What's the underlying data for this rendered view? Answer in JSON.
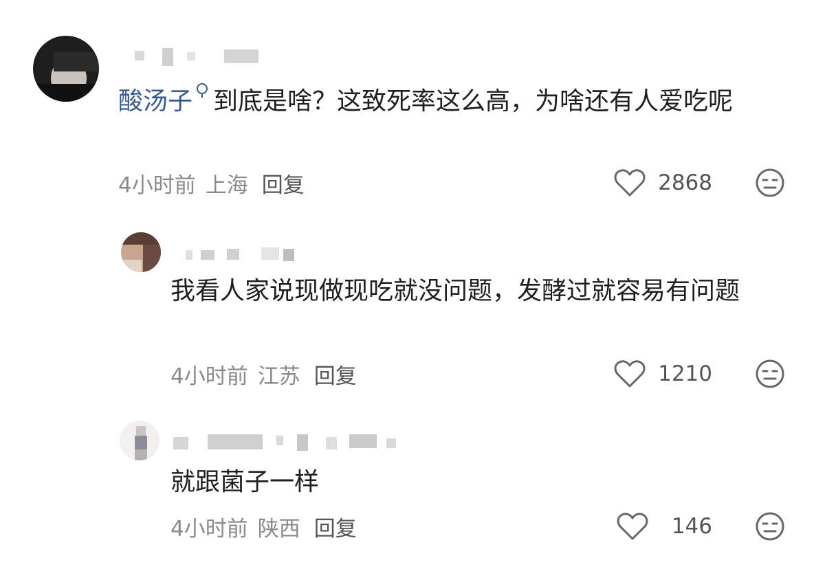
{
  "comments": [
    {
      "keyword": "酸汤子",
      "text": "到底是啥？这致死率这么高，为啥还有人爱吃呢",
      "time": "4小时前",
      "location": "上海",
      "reply_label": "回复",
      "likes": "2868"
    },
    {
      "text": "我看人家说现做现吃就没问题，发酵过就容易有问题",
      "time": "4小时前",
      "location": "江苏",
      "reply_label": "回复",
      "likes": "1210"
    },
    {
      "text": "就跟菌子一样",
      "time": "4小时前",
      "location": "陕西",
      "reply_label": "回复",
      "likes": "146"
    }
  ],
  "icons": {
    "like": "heart-outline-icon",
    "dislike": "meh-face-icon",
    "keyword_search": "search-icon"
  },
  "colors": {
    "keyword": "#3a5a8c",
    "meta": "#8a8a8a",
    "text": "#1f1f1f"
  }
}
